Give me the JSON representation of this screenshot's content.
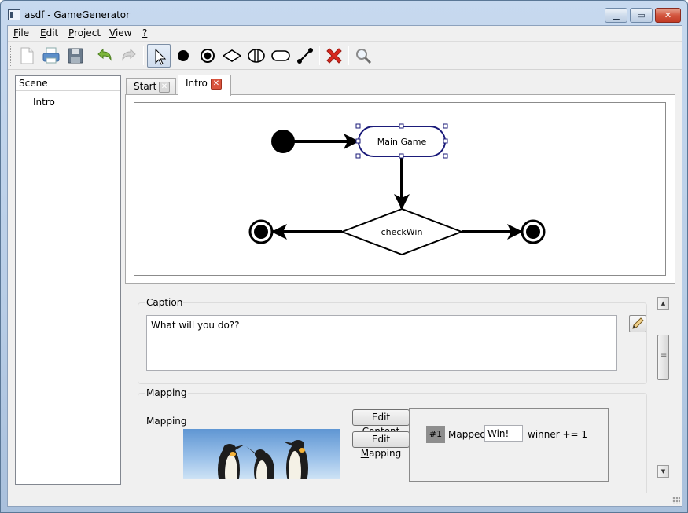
{
  "window": {
    "title": "asdf - GameGenerator"
  },
  "menu": [
    {
      "key": "F",
      "rest": "ile"
    },
    {
      "key": "E",
      "rest": "dit"
    },
    {
      "key": "P",
      "rest": "roject"
    },
    {
      "key": "V",
      "rest": "iew"
    },
    {
      "key": "?",
      "rest": ""
    }
  ],
  "toolbar": {
    "buttons": [
      "new-file-icon",
      "print-icon",
      "save-icon",
      "undo-icon",
      "redo-icon",
      "select-pointer-icon",
      "initial-state-icon",
      "final-state-icon",
      "decision-icon",
      "fork-join-icon",
      "state-icon",
      "transition-icon",
      "delete-icon",
      "zoom-icon"
    ],
    "active": "select-pointer-icon"
  },
  "scene": {
    "header": "Scene",
    "items": [
      "Intro"
    ]
  },
  "tabs": [
    {
      "label": "Start",
      "active": false
    },
    {
      "label": "Intro",
      "active": true
    }
  ],
  "diagram": {
    "nodes": [
      {
        "id": "start",
        "type": "initial"
      },
      {
        "id": "main",
        "type": "state",
        "label": "Main Game",
        "selected": true
      },
      {
        "id": "check",
        "type": "decision",
        "label": "checkWin"
      },
      {
        "id": "endL",
        "type": "final"
      },
      {
        "id": "endR",
        "type": "final"
      }
    ],
    "edges": [
      {
        "from": "start",
        "to": "main"
      },
      {
        "from": "main",
        "to": "check"
      },
      {
        "from": "check",
        "to": "endL"
      },
      {
        "from": "check",
        "to": "endR"
      }
    ]
  },
  "caption": {
    "title": "Caption",
    "text": "What will you do??"
  },
  "mapping": {
    "title": "Mapping",
    "label": "Mapping",
    "edit_content_label": "Edit Content",
    "edit_content_key": "C",
    "edit_mapping_label": "Edit Mapping",
    "edit_mapping_key": "M",
    "entries": [
      {
        "number": "#1",
        "status": "Mapped",
        "value": "Win!",
        "action": "winner += 1"
      }
    ]
  },
  "colors": {
    "selection": "#1b1b7a",
    "delete": "#d8281f",
    "tab_close_active": "#d9533d"
  }
}
